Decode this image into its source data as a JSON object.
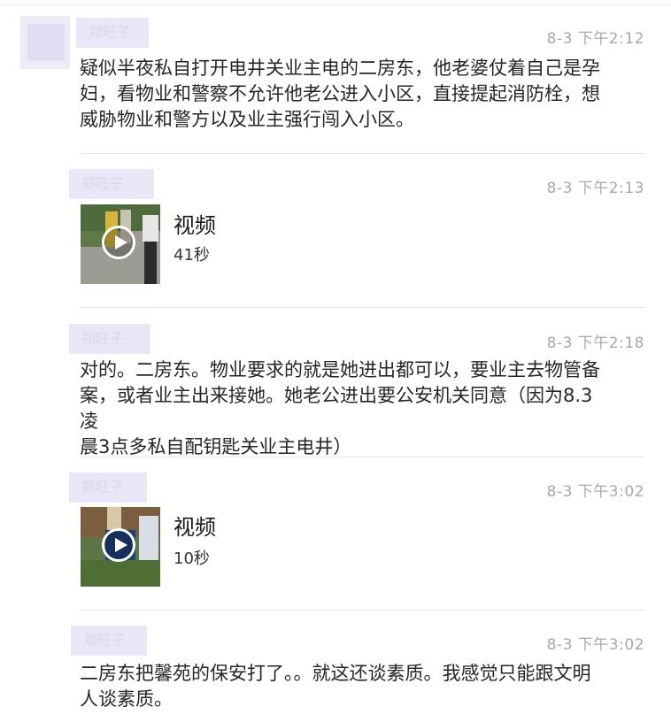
{
  "messages": [
    {
      "sender": "郑旺子",
      "time": "8-3 下午2:12",
      "text_lines": [
        "疑似半夜私自打开电井关业主电的二房东，他老婆仗着自己是孕",
        "妇，看物业和警察不允许他老公进入小区，直接提起消防栓，想",
        "威胁物业和警方以及业主强行闯入小区。"
      ]
    },
    {
      "sender": "郑旺子",
      "time": "8-3 下午2:13",
      "video": {
        "title": "视频",
        "duration": "41秒"
      }
    },
    {
      "sender": "郑旺子",
      "time": "8-3 下午2:18",
      "text_lines": [
        "对的。二房东。物业要求的就是她进出都可以，要业主去物管备",
        "案，或者业主出来接她。她老公进出要公安机关同意（因为8.3凌",
        "晨3点多私自配钥匙关业主电井）"
      ]
    },
    {
      "sender": "郑旺子",
      "time": "8-3 下午3:02",
      "video": {
        "title": "视频",
        "duration": "10秒"
      }
    },
    {
      "sender": "郑旺子",
      "time": "8-3 下午3:02",
      "text_lines": [
        "二房东把馨苑的保安打了。。就这还谈素质。我感觉只能跟文明",
        "人谈素质。"
      ]
    }
  ]
}
